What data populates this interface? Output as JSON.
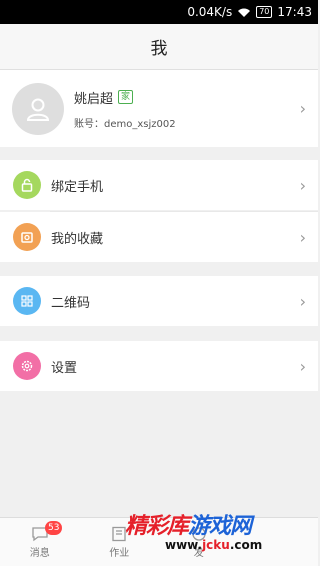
{
  "status_bar": {
    "speed": "0.04K/s",
    "battery": "70",
    "time": "17:43"
  },
  "header": {
    "title": "我"
  },
  "profile": {
    "name": "姚启超",
    "badge": "家",
    "account": "账号：demo_xsjz002"
  },
  "menu": [
    {
      "label": "绑定手机",
      "icon": "lock-icon",
      "color": "#a5d85e"
    },
    {
      "label": "我的收藏",
      "icon": "favorites-icon",
      "color": "#f2a154"
    },
    {
      "label": "二维码",
      "icon": "qr-code-icon",
      "color": "#5ab7f2"
    },
    {
      "label": "设置",
      "icon": "gear-icon",
      "color": "#f26fa6"
    }
  ],
  "bottom_nav": [
    {
      "label": "消息",
      "badge": "53"
    },
    {
      "label": "作业"
    },
    {
      "label": "发"
    },
    {
      "label": ""
    }
  ],
  "watermark": {
    "text_red": "精彩库",
    "text_blue": "游戏网",
    "url_prefix": "www.",
    "url_mid": "jcku",
    "url_suffix": ".com"
  }
}
